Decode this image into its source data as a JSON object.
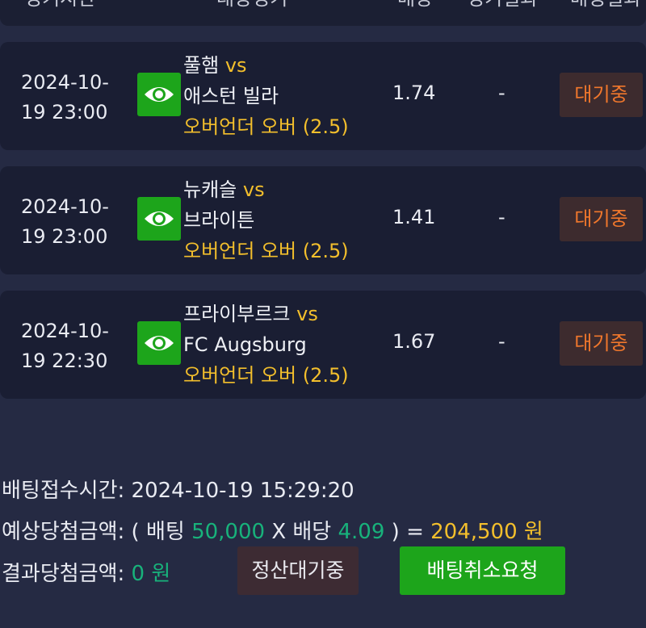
{
  "table_header": {
    "col_time": "경기시간",
    "col_match": "대상경기",
    "col_odds": "배당",
    "col_result": "경기결과",
    "col_status": "배팅결과"
  },
  "bets": [
    {
      "date_line1": "2024-10-",
      "date_line2": "19 23:00",
      "home": "풀햄",
      "vs": "vs",
      "away": "애스턴 빌라",
      "pick": "오버언더 오버 (2.5)",
      "odds": "1.74",
      "result": "-",
      "status": "대기중"
    },
    {
      "date_line1": "2024-10-",
      "date_line2": "19 23:00",
      "home": "뉴캐슬",
      "vs": "vs",
      "away": "브라이튼",
      "pick": "오버언더 오버 (2.5)",
      "odds": "1.41",
      "result": "-",
      "status": "대기중"
    },
    {
      "date_line1": "2024-10-",
      "date_line2": "19 22:30",
      "home": "프라이부르크",
      "vs": "vs",
      "away": "FC Augsburg",
      "pick": "오버언더 오버 (2.5)",
      "odds": "1.67",
      "result": "-",
      "status": "대기중"
    }
  ],
  "summary": {
    "received_label": "배팅접수시간:",
    "received_value": "2024-10-19 15:29:20",
    "expected_label": "예상당첨금액:",
    "open_paren": "( 배팅",
    "stake": "50,000",
    "times": "X 배당",
    "total_odds": "4.09",
    "close_paren": ") =",
    "expected_amount": "204,500 원",
    "result_label": "결과당첨금액:",
    "result_amount": "0 원"
  },
  "buttons": {
    "pending_label": "정산대기중",
    "cancel_label": "배팅취소요청"
  },
  "colors": {
    "background": "#252a43",
    "card": "#1a1e33",
    "accent_gold": "#f3bf2c",
    "accent_green": "#18b27b",
    "button_green": "#1da51b",
    "status_orange": "#f0772c"
  },
  "icons": {
    "view": "eye-icon"
  }
}
